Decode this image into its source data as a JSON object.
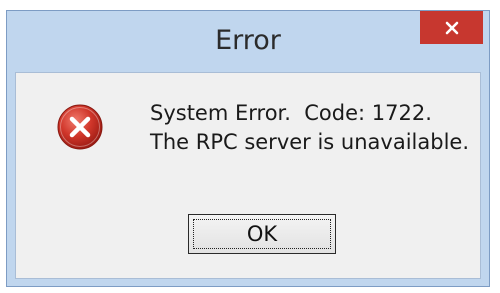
{
  "window": {
    "title": "Error",
    "close_icon": "close-icon"
  },
  "dialog": {
    "icon": "error-icon",
    "message_line1": "System Error.  Code: 1722.",
    "message_line2": "The RPC server is unavailable.",
    "ok_label": "OK"
  },
  "colors": {
    "frame": "#c0d6ee",
    "close_button": "#c7372f",
    "client_background": "#f0f0f0",
    "error_icon": "#d0362a"
  }
}
